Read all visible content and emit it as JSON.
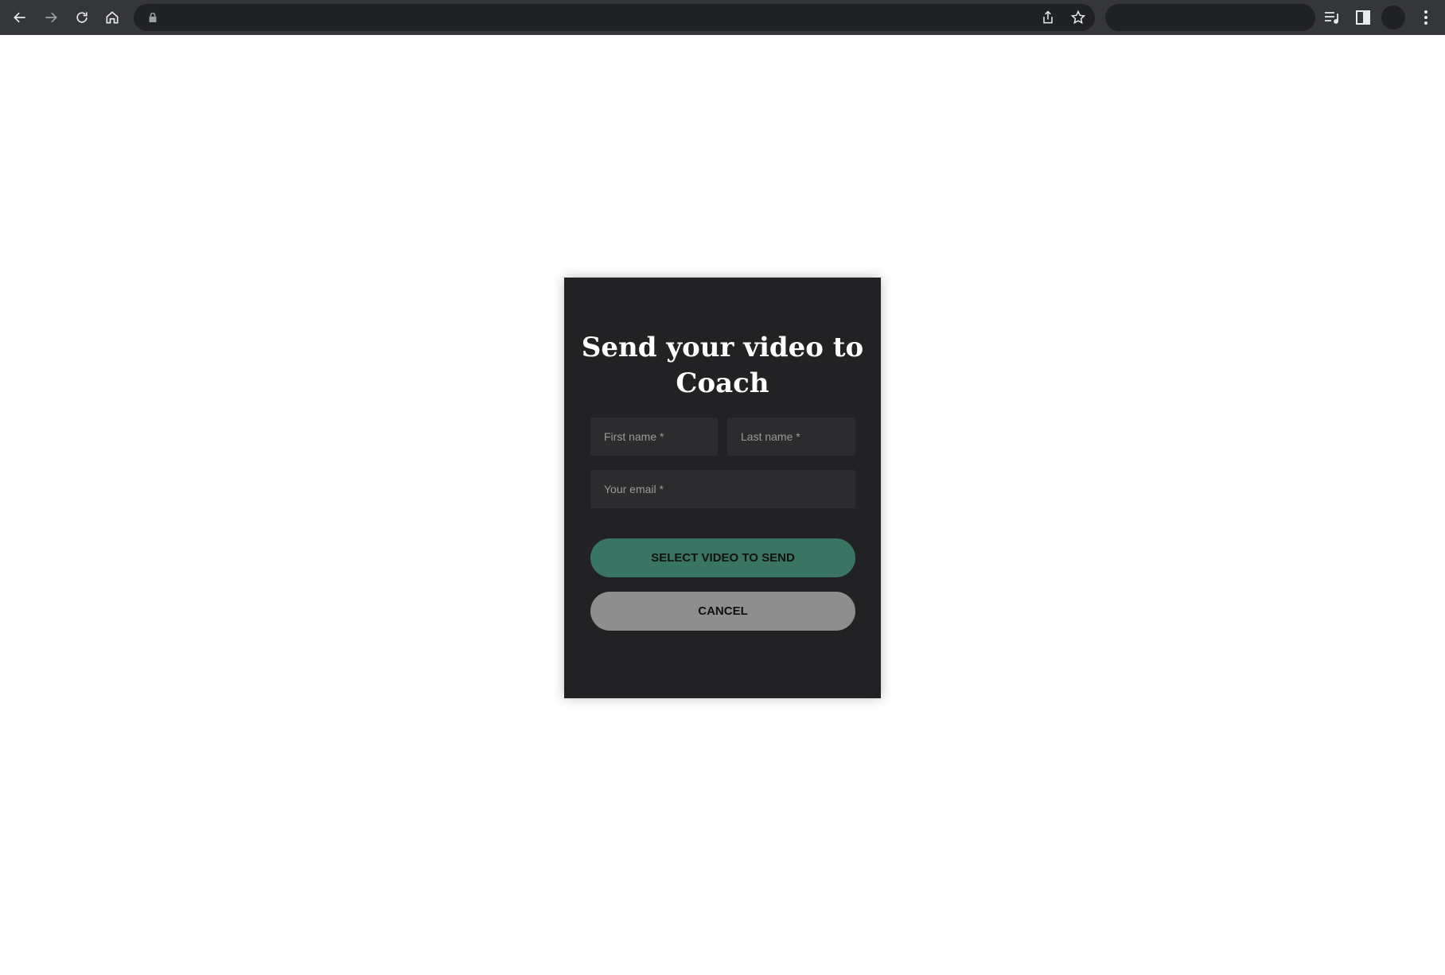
{
  "browser": {
    "back_icon": "arrow-left-icon",
    "forward_icon": "arrow-right-icon",
    "reload_icon": "reload-icon",
    "home_icon": "home-icon",
    "lock_icon": "lock-icon",
    "share_icon": "share-icon",
    "star_icon": "star-icon",
    "media_icon": "media-control-icon",
    "sidepanel_icon": "side-panel-icon",
    "menu_icon": "kebab-menu-icon",
    "url": ""
  },
  "modal": {
    "title": "Send your video to Coach",
    "first_name_placeholder": "First name *",
    "last_name_placeholder": "Last name *",
    "email_placeholder": "Your email *",
    "select_button_label": "SELECT VIDEO TO SEND",
    "cancel_button_label": "CANCEL"
  },
  "colors": {
    "browser_bar": "#35363a",
    "modal_bg": "#222224",
    "field_bg": "#2c2c2e",
    "primary_button": "#3a7462",
    "secondary_button": "#8e8e8e"
  }
}
